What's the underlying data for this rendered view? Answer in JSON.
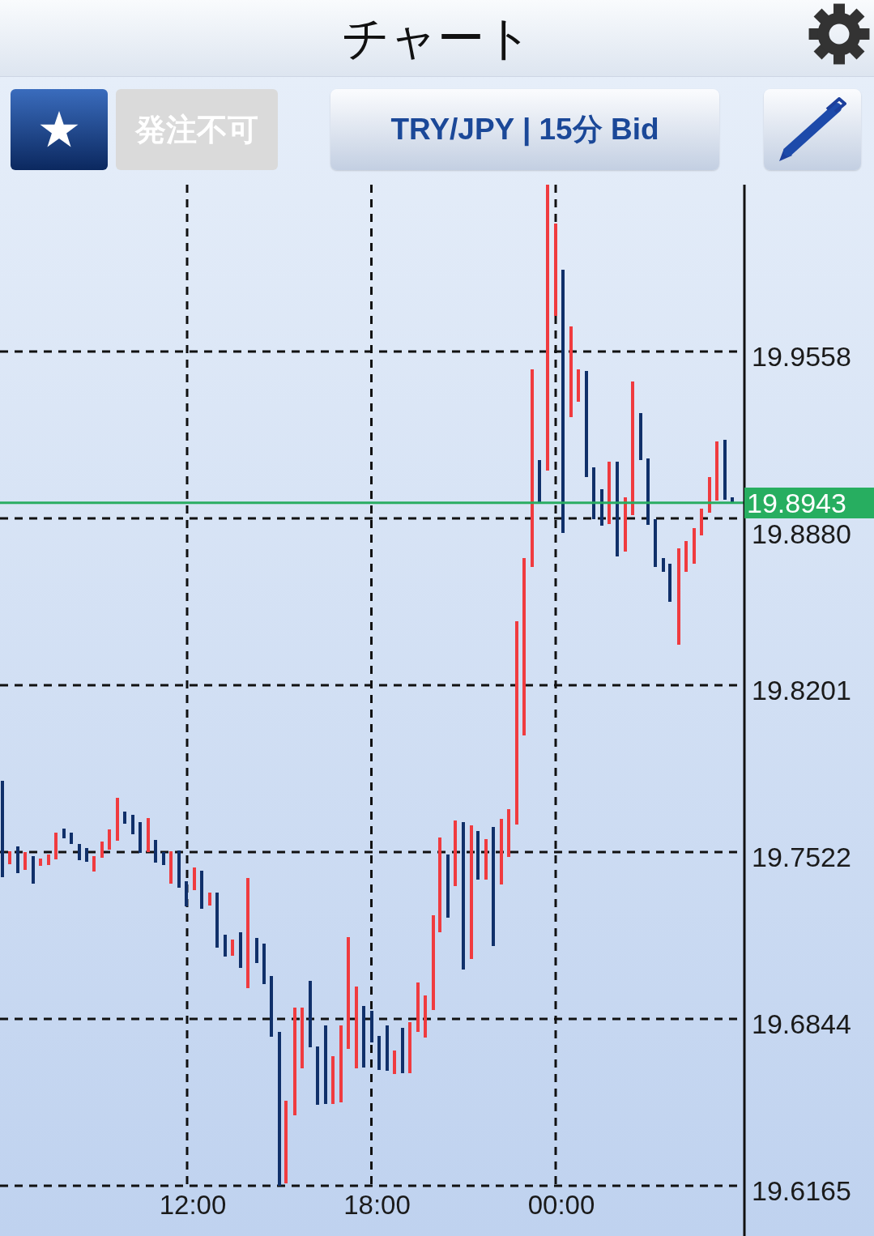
{
  "header": {
    "title": "チャート"
  },
  "toolbar": {
    "buttons": [
      {
        "kind": "star"
      },
      {
        "kind": "order",
        "label": "発注不可",
        "disabled": true
      },
      {
        "kind": "symbol",
        "label": "TRY/JPY | 15分 Bid"
      },
      {
        "kind": "pen"
      }
    ]
  },
  "chart": {
    "price_labels": [
      "19.9558",
      "19.8880",
      "19.8201",
      "19.7522",
      "19.6844",
      "19.6165"
    ],
    "time_labels": [
      "12:00",
      "18:00",
      "00:00"
    ],
    "current_price": "19.8943"
  }
}
